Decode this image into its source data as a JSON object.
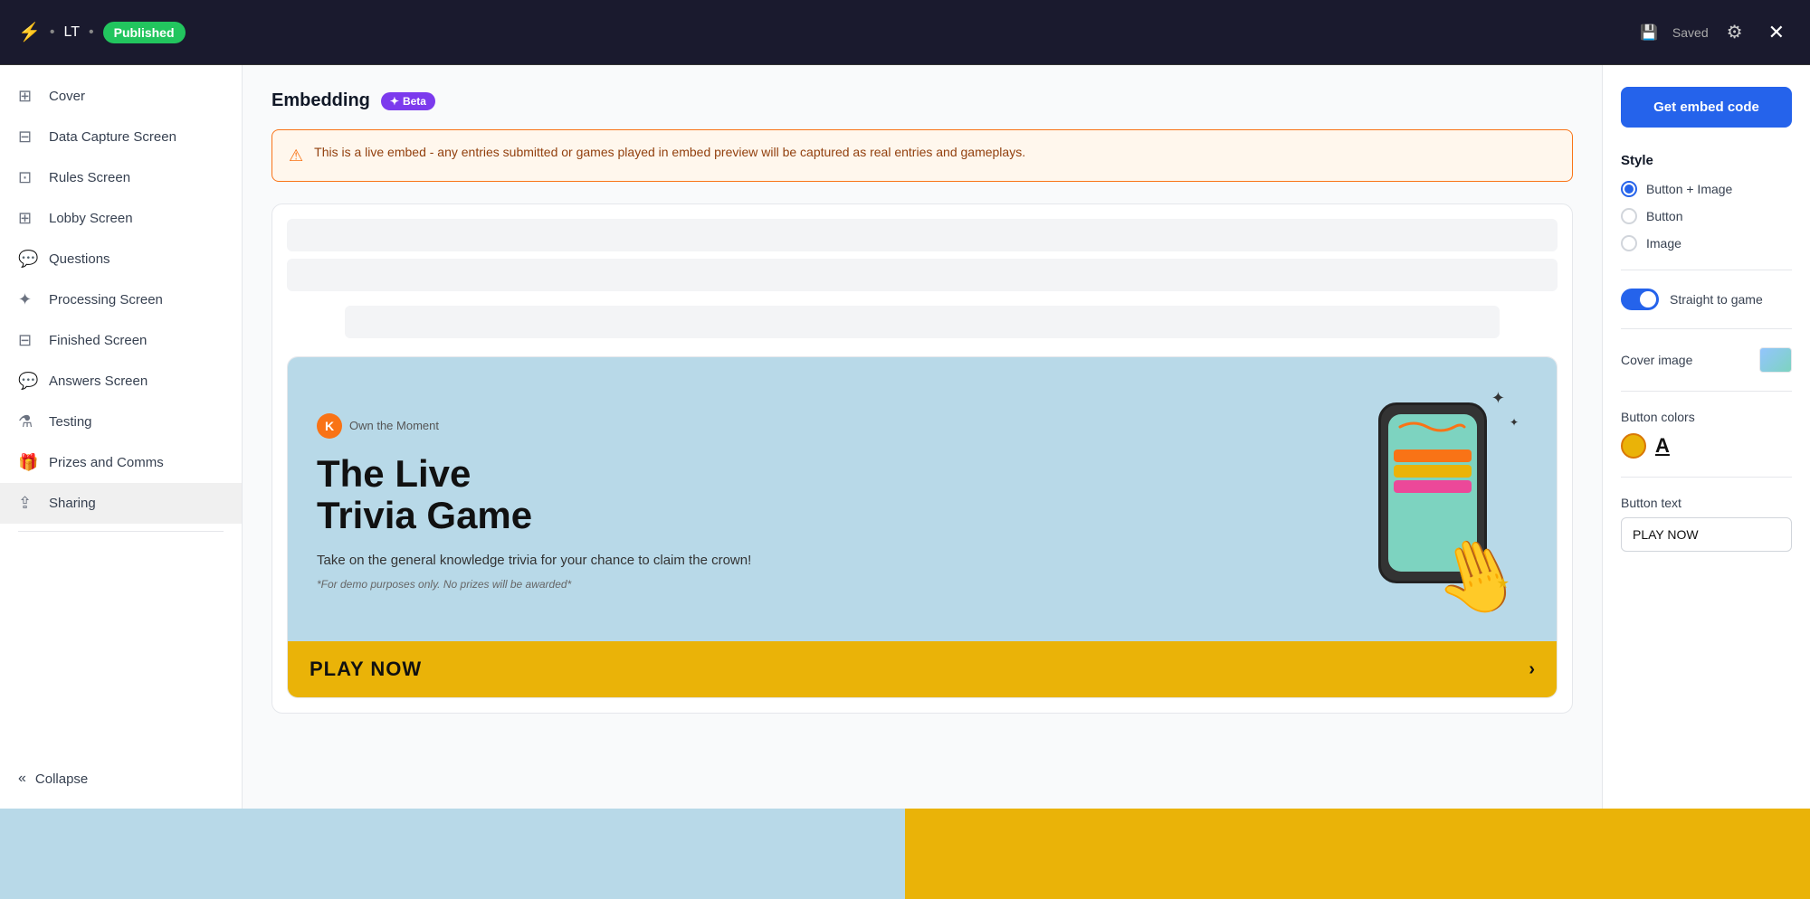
{
  "header": {
    "bolt_icon": "⚡",
    "title": "LT",
    "dot": "•",
    "published_label": "Published",
    "saved_label": "Saved",
    "close_icon": "✕"
  },
  "sidebar": {
    "items": [
      {
        "id": "cover",
        "label": "Cover",
        "icon": "▣"
      },
      {
        "id": "data-capture",
        "label": "Data Capture Screen",
        "icon": "⊞"
      },
      {
        "id": "rules",
        "label": "Rules Screen",
        "icon": "⊟"
      },
      {
        "id": "lobby",
        "label": "Lobby Screen",
        "icon": "⊡"
      },
      {
        "id": "questions",
        "label": "Questions",
        "icon": "💬"
      },
      {
        "id": "processing",
        "label": "Processing Screen",
        "icon": "✦"
      },
      {
        "id": "finished",
        "label": "Finished Screen",
        "icon": "⊞"
      },
      {
        "id": "answers",
        "label": "Answers Screen",
        "icon": "💬"
      },
      {
        "id": "testing",
        "label": "Testing",
        "icon": "⚗"
      },
      {
        "id": "prizes",
        "label": "Prizes and Comms",
        "icon": "🎁"
      },
      {
        "id": "sharing",
        "label": "Sharing",
        "icon": "⇪"
      }
    ],
    "collapse_label": "Collapse"
  },
  "main": {
    "section_title": "Embedding",
    "beta_label": "Beta",
    "warning_text": "This is a live embed - any entries submitted or games played in embed preview will be captured as real entries and gameplays.",
    "embed_card": {
      "brand_initial": "K",
      "brand_name": "Own the Moment",
      "game_title_line1": "The Live",
      "game_title_line2": "Trivia Game",
      "game_desc": "Take on the general knowledge trivia for your chance to claim the crown!",
      "demo_note": "*For demo purposes only. No prizes will be awarded*",
      "play_button_text": "PLAY NOW"
    }
  },
  "right_panel": {
    "get_embed_button": "Get embed code",
    "style_title": "Style",
    "style_options": [
      {
        "id": "button-image",
        "label": "Button + Image",
        "selected": true
      },
      {
        "id": "button",
        "label": "Button",
        "selected": false
      },
      {
        "id": "image",
        "label": "Image",
        "selected": false
      }
    ],
    "straight_to_game_label": "Straight to game",
    "cover_image_label": "Cover image",
    "button_colors_label": "Button colors",
    "button_text_label": "Button text",
    "button_text_value": "PLAY NOW"
  }
}
